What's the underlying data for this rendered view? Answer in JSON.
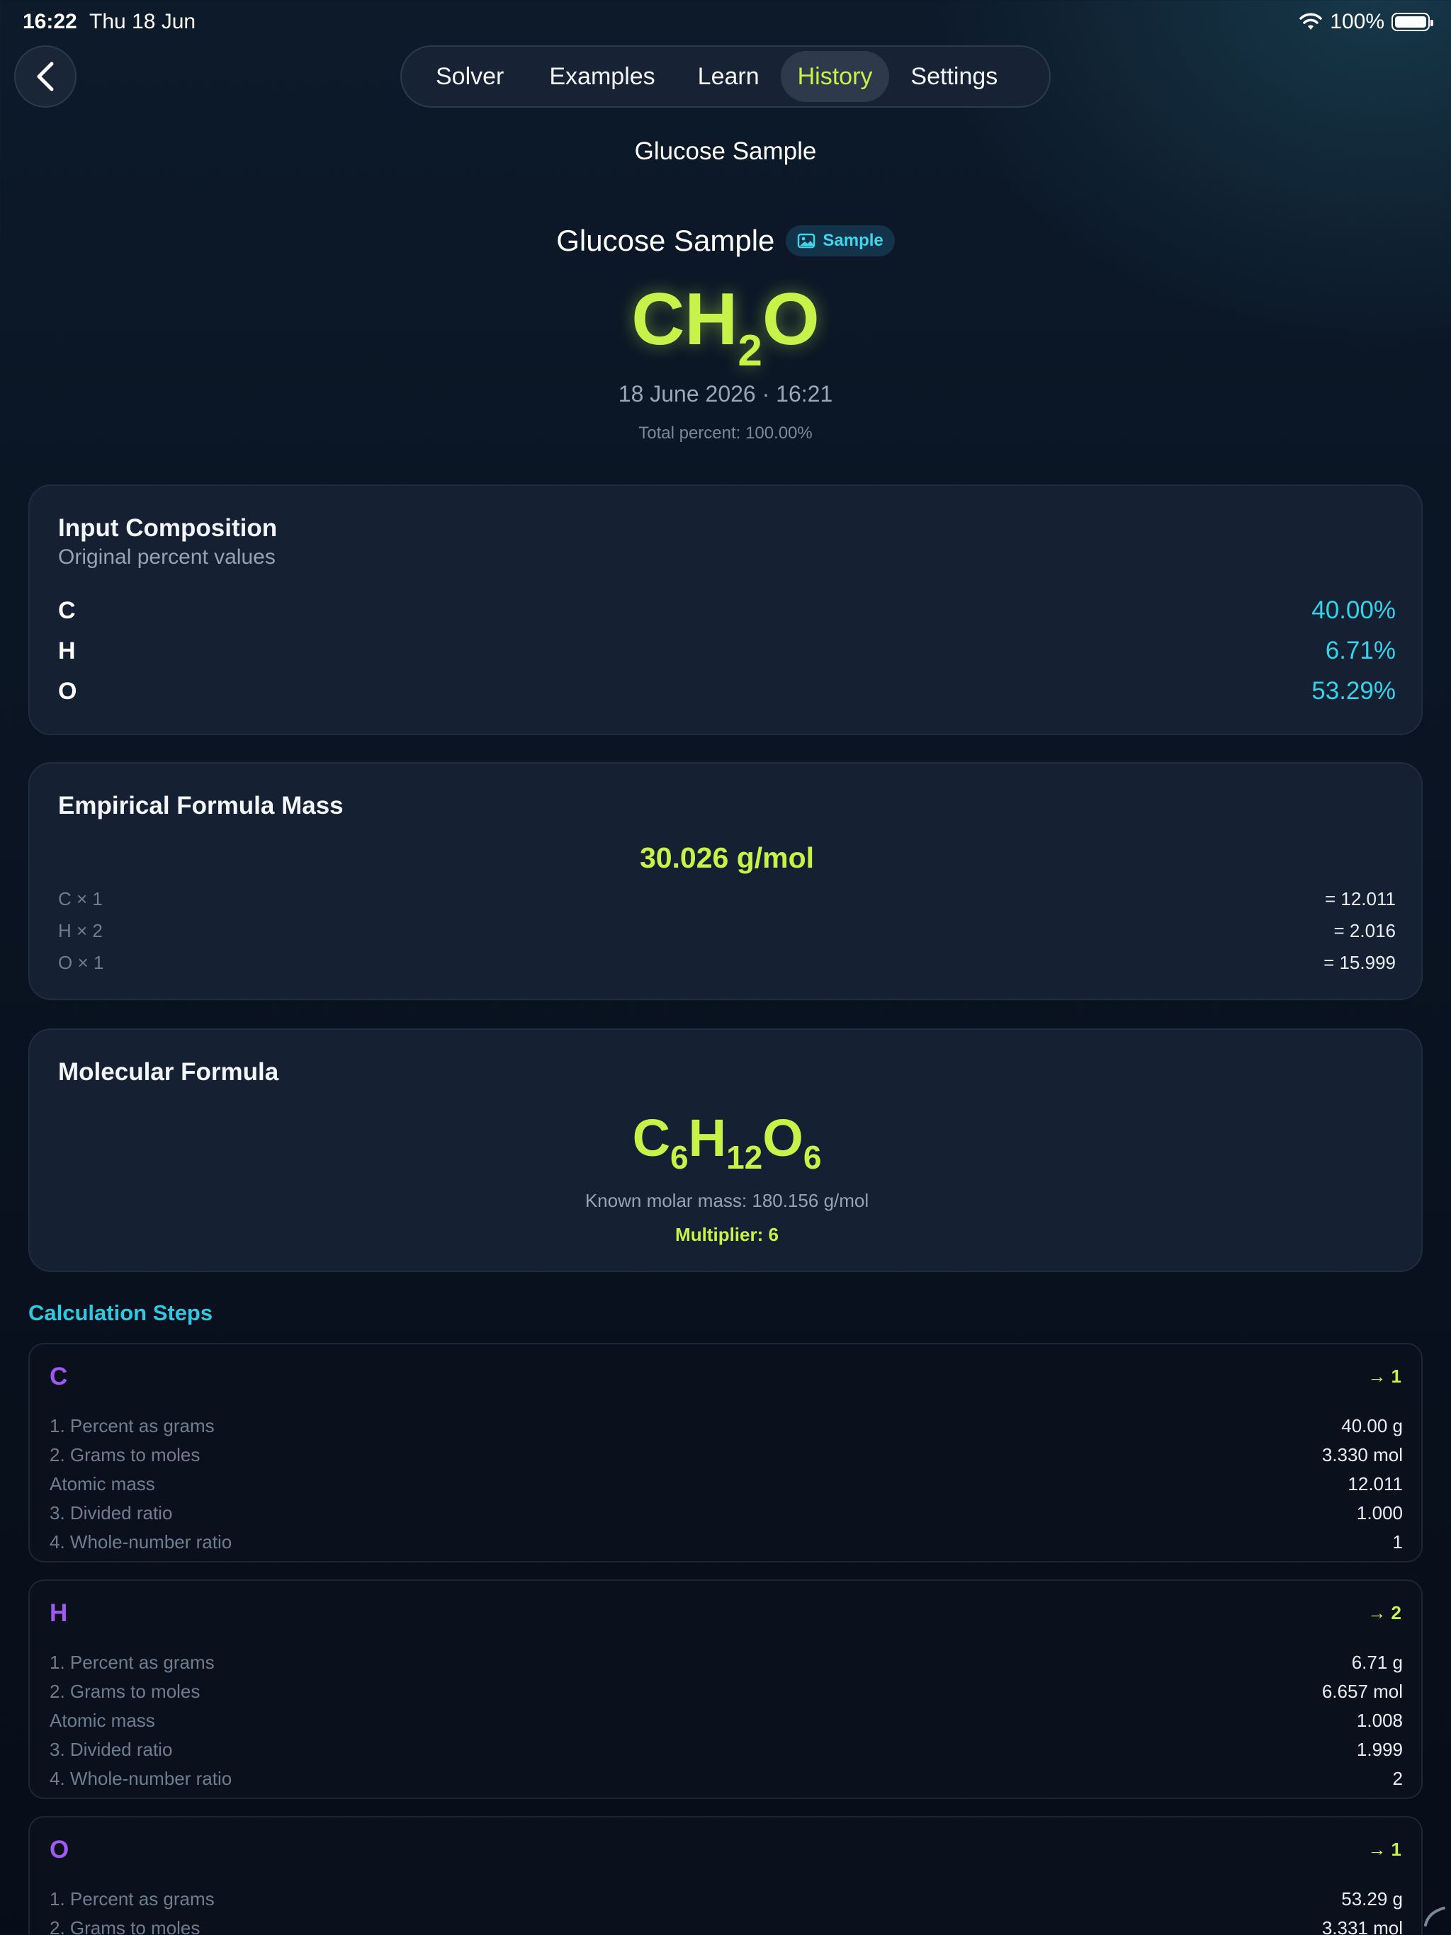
{
  "status_bar": {
    "time": "16:22",
    "date": "Thu 18 Jun",
    "battery": "100%"
  },
  "tabs": [
    {
      "label": "Solver",
      "active": false
    },
    {
      "label": "Examples",
      "active": false
    },
    {
      "label": "Learn",
      "active": false
    },
    {
      "label": "History",
      "active": true
    },
    {
      "label": "Settings",
      "active": false
    }
  ],
  "nav_title": "Glucose Sample",
  "header": {
    "name": "Glucose Sample",
    "badge": "Sample",
    "formula": {
      "p1": "CH",
      "s1": "2",
      "p2": "O"
    },
    "date": "18 June 2026 · 16:21",
    "total_percent": "Total percent: 100.00%"
  },
  "input_composition": {
    "title": "Input Composition",
    "subtitle": "Original percent values",
    "rows": [
      {
        "element": "C",
        "value": "40.00%"
      },
      {
        "element": "H",
        "value": "6.71%"
      },
      {
        "element": "O",
        "value": "53.29%"
      }
    ]
  },
  "empirical_mass": {
    "title": "Empirical Formula Mass",
    "total": "30.026 g/mol",
    "rows": [
      {
        "label": "C × 1",
        "value": "= 12.011"
      },
      {
        "label": "H × 2",
        "value": "= 2.016"
      },
      {
        "label": "O × 1",
        "value": "= 15.999"
      }
    ]
  },
  "molecular_formula": {
    "title": "Molecular Formula",
    "formula": {
      "p1": "C",
      "s1": "6",
      "p2": "H",
      "s2": "12",
      "p3": "O",
      "s3": "6"
    },
    "known_mass": "Known molar mass: 180.156 g/mol",
    "multiplier": "Multiplier: 6"
  },
  "calculation_steps": {
    "heading": "Calculation Steps",
    "steps": [
      {
        "element": "C",
        "result": "→ 1",
        "rows": [
          {
            "label": "1. Percent as grams",
            "value": "40.00 g"
          },
          {
            "label": "2. Grams to moles",
            "value": "3.330 mol"
          },
          {
            "label": "Atomic mass",
            "value": "12.011"
          },
          {
            "label": "3. Divided ratio",
            "value": "1.000"
          },
          {
            "label": "4. Whole-number ratio",
            "value": "1"
          }
        ]
      },
      {
        "element": "H",
        "result": "→ 2",
        "rows": [
          {
            "label": "1. Percent as grams",
            "value": "6.71 g"
          },
          {
            "label": "2. Grams to moles",
            "value": "6.657 mol"
          },
          {
            "label": "Atomic mass",
            "value": "1.008"
          },
          {
            "label": "3. Divided ratio",
            "value": "1.999"
          },
          {
            "label": "4. Whole-number ratio",
            "value": "2"
          }
        ]
      },
      {
        "element": "O",
        "result": "→ 1",
        "rows": [
          {
            "label": "1. Percent as grams",
            "value": "53.29 g"
          },
          {
            "label": "2. Grams to moles",
            "value": "3.331 mol"
          }
        ]
      }
    ]
  },
  "colors": {
    "accent_green": "#c6f24a",
    "accent_cyan": "#33d3e8",
    "element_purple": "#a05af0"
  },
  "icons": [
    "back-chevron-icon",
    "wifi-icon",
    "battery-icon",
    "image-icon",
    "scroll-indicator-icon"
  ]
}
